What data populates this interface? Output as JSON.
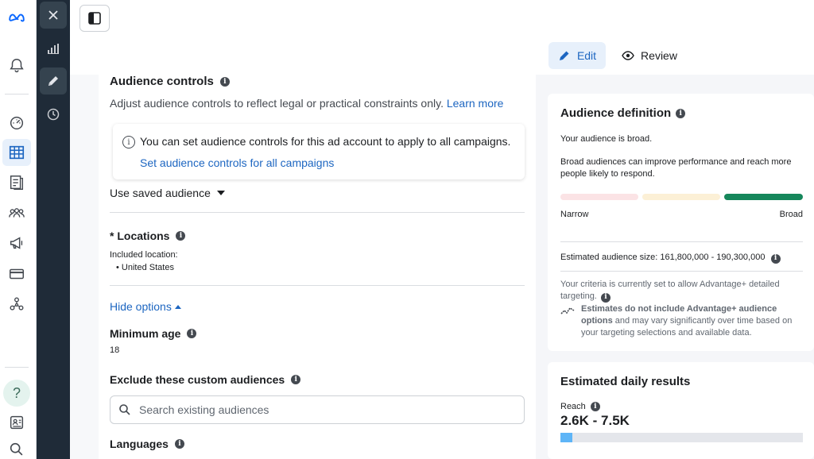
{
  "nav": {
    "tabs": {
      "edit": "Edit",
      "review": "Review"
    }
  },
  "audience_controls": {
    "title": "Audience controls",
    "subtitle": "Adjust audience controls to reflect legal or practical constraints only.",
    "learn_more": "Learn more",
    "notice_text": "You can set audience controls for this ad account to apply to all campaigns.",
    "notice_link": "Set audience controls for all campaigns",
    "saved_audience": "Use saved audience",
    "locations_title": "* Locations",
    "included_location_label": "Included location:",
    "included_location": "United States",
    "hide_options": "Hide options",
    "min_age_title": "Minimum age",
    "min_age_value": "18",
    "exclude_title": "Exclude these custom audiences",
    "search_placeholder": "Search existing audiences",
    "languages_title": "Languages"
  },
  "audience_definition": {
    "title": "Audience definition",
    "broad_line": "Your audience is broad.",
    "broad_desc": "Broad audiences can improve performance and reach more people likely to respond.",
    "meter_level": "broad",
    "narrow_label": "Narrow",
    "broad_label": "Broad",
    "estimated_size": "Estimated audience size: 161,800,000 - 190,300,000",
    "criteria_text": "Your criteria is currently set to allow Advantage+ detailed targeting.",
    "estimates_bold": "Estimates do not include Advantage+ audience options",
    "estimates_rest": " and may vary significantly over time based on your targeting selections and available data."
  },
  "daily_results": {
    "title": "Estimated daily results",
    "reach_label": "Reach",
    "reach_value": "2.6K - 7.5K",
    "reach_fill_fraction": 0.05
  },
  "colors": {
    "accent": "#1d66c1",
    "meter_low": "#f8d7da",
    "meter_mid": "#fbecc8",
    "meter_high": "#16875b",
    "dark_rail": "#1f2b38",
    "reach_fill": "#5eb5f7"
  },
  "icons": {
    "rail": [
      "meta-logo-icon",
      "bell-icon",
      "gauge-icon",
      "table-grid-icon",
      "document-icon",
      "people-icon",
      "megaphone-icon",
      "credit-card-icon",
      "network-icon",
      "help-icon",
      "contacts-icon",
      "search-icon"
    ],
    "dark": [
      "close-icon",
      "bar-chart-icon",
      "pencil-icon",
      "clock-icon"
    ]
  }
}
